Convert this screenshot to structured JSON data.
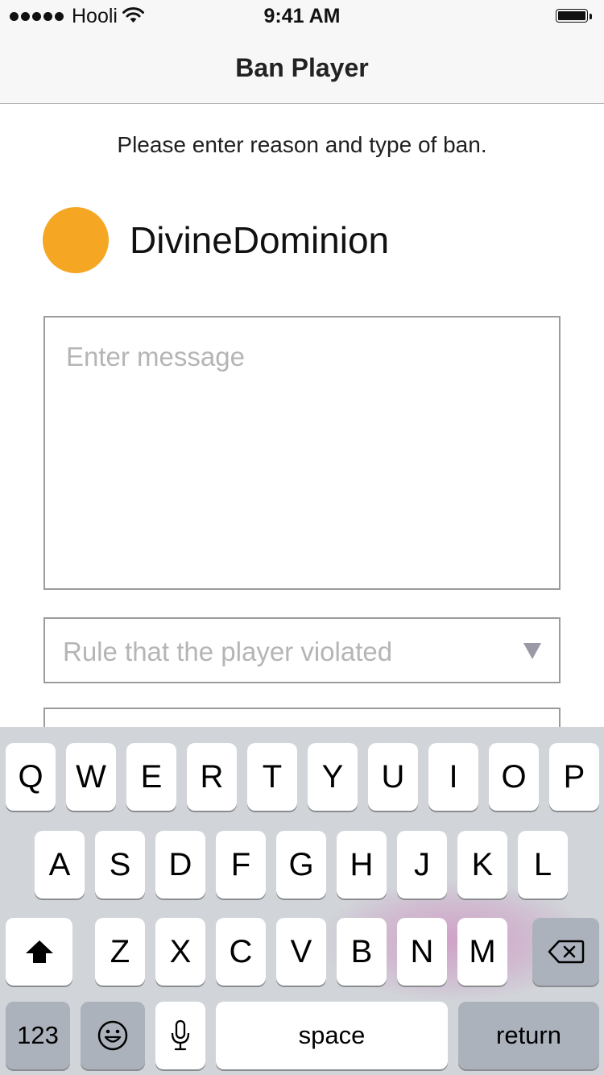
{
  "status_bar": {
    "carrier": "Hooli",
    "time": "9:41 AM",
    "signal_icon": "signal-dots-icon",
    "wifi_icon": "wifi-icon",
    "battery_icon": "battery-icon"
  },
  "nav": {
    "title": "Ban Player"
  },
  "instruction": "Please enter reason and type of ban.",
  "player": {
    "name": "DivineDominion",
    "avatar_color": "#f5a623"
  },
  "message": {
    "placeholder": "Enter message",
    "value": ""
  },
  "rule_select": {
    "placeholder": "Rule that the player violated",
    "icon": "dropdown-arrow-icon"
  },
  "keyboard": {
    "row1": [
      "Q",
      "W",
      "E",
      "R",
      "T",
      "Y",
      "U",
      "I",
      "O",
      "P"
    ],
    "row2": [
      "A",
      "S",
      "D",
      "F",
      "G",
      "H",
      "J",
      "K",
      "L"
    ],
    "row3": [
      "Z",
      "X",
      "C",
      "V",
      "B",
      "N",
      "M"
    ],
    "shift_icon": "shift-icon",
    "delete_icon": "backspace-icon",
    "numbers_label": "123",
    "emoji_icon": "emoji-icon",
    "mic_icon": "microphone-icon",
    "space_label": "space",
    "return_label": "return"
  }
}
